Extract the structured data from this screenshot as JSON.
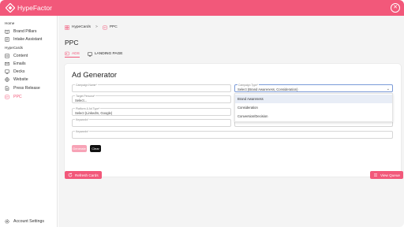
{
  "app": {
    "name": "HypeFactor",
    "brand_color": "#f2587a"
  },
  "sidebar": {
    "sections": [
      {
        "label": "Home"
      },
      {
        "label": "HypeCards"
      }
    ],
    "items": [
      {
        "label": "Brand Pillars",
        "icon": "book-icon"
      },
      {
        "label": "Intake Assistant",
        "icon": "form-icon"
      },
      {
        "label": "Content",
        "icon": "content-icon"
      },
      {
        "label": "Emails",
        "icon": "mail-icon"
      },
      {
        "label": "Decks",
        "icon": "deck-icon"
      },
      {
        "label": "Website",
        "icon": "globe-icon"
      },
      {
        "label": "Press Release",
        "icon": "document-icon"
      },
      {
        "label": "PPC",
        "icon": "ppc-icon",
        "active": true
      }
    ],
    "footer": {
      "label": "Account Settings",
      "icon": "gear-icon"
    }
  },
  "breadcrumb": {
    "items": [
      "HypeCards",
      "PPC"
    ],
    "separator": ">"
  },
  "page": {
    "title": "PPC",
    "tabs": [
      {
        "label": "ADS",
        "active": true
      },
      {
        "label": "LANDING PAGE",
        "active": false
      }
    ]
  },
  "ad_generator": {
    "title": "Ad Generator",
    "fields": {
      "campaign_name": {
        "label": "Campaign Name*",
        "value": ""
      },
      "campaign_type": {
        "label": "Campaign Type*",
        "value": "Select (Brand Awareness, Consideration)"
      },
      "target_persona": {
        "label": "Target Persona*",
        "value": "Select..."
      },
      "platform": {
        "label": "Platform & Ad Type*",
        "value": "Select (LinkedIn, Google)"
      },
      "field_a": {
        "label": "Keywords*",
        "value": ""
      },
      "field_b": {
        "label": "",
        "value": ""
      },
      "keywords": {
        "label": "Keywords*",
        "value": ""
      }
    },
    "dropdown_options": [
      "Brand Awareness",
      "Consideration",
      "Conversion/Decision"
    ],
    "highlighted_option": "Brand Awareness",
    "buttons": {
      "generate": "Generate",
      "clear": "Clear"
    }
  },
  "actions": {
    "refresh": "Refresh Cards",
    "view_queue": "View Queue"
  }
}
